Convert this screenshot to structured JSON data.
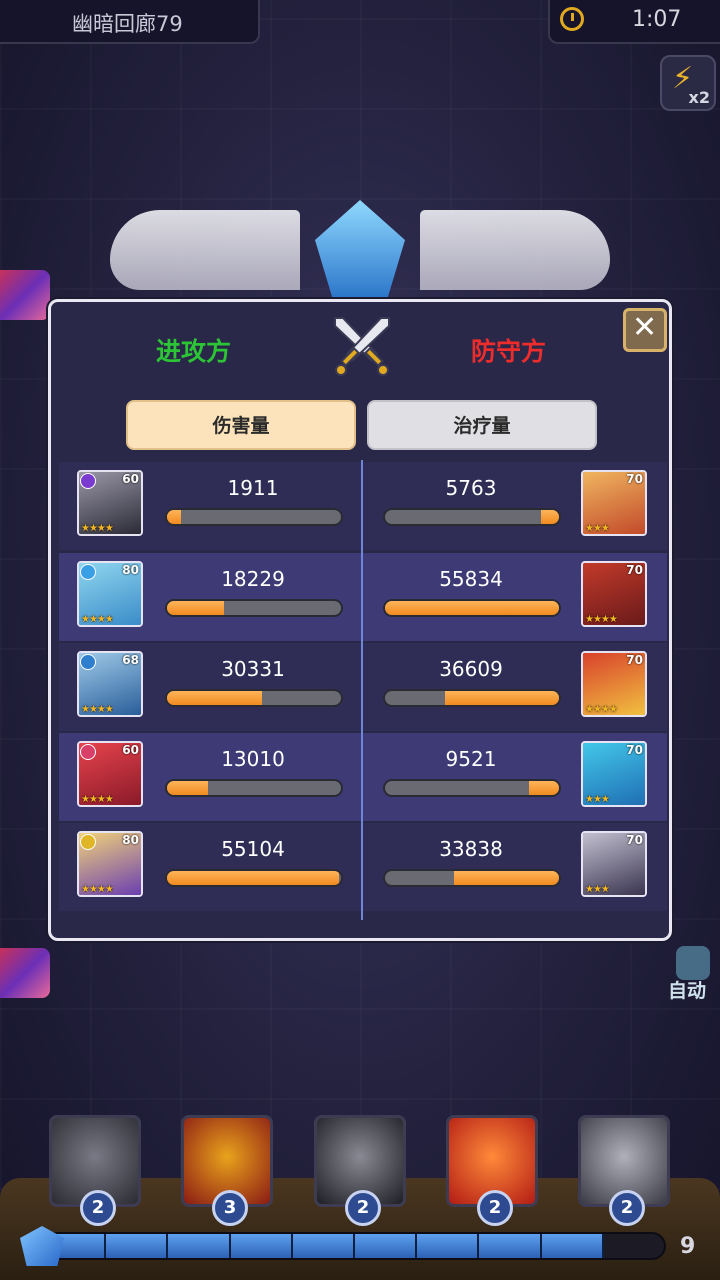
{
  "header": {
    "stage_name": "幽暗回廊79",
    "timer": "1:07",
    "speed_label": "x2",
    "auto_label": "自动"
  },
  "dialog": {
    "attacker_label": "进攻方",
    "defender_label": "防守方",
    "close_icon": "close-icon",
    "tabs": [
      {
        "label": "伤害量",
        "active": true
      },
      {
        "label": "治疗量",
        "active": false
      }
    ],
    "max_value": 55834,
    "rows": [
      {
        "left": {
          "value": "1911",
          "level": "60",
          "stars": "★★★★",
          "element_color": "#7b3bd0",
          "face": [
            "#9a98a8",
            "#2b2a36"
          ]
        },
        "right": {
          "value": "5763",
          "level": "70",
          "stars": "★★★",
          "face": [
            "#f0b560",
            "#c24a2a"
          ]
        }
      },
      {
        "left": {
          "value": "18229",
          "level": "80",
          "stars": "★★★★",
          "element_color": "#3aa0e6",
          "face": [
            "#8fd6ef",
            "#3b8cc9"
          ]
        },
        "right": {
          "value": "55834",
          "level": "70",
          "stars": "★★★★",
          "face": [
            "#c23a2a",
            "#6a1a1a"
          ]
        }
      },
      {
        "left": {
          "value": "30331",
          "level": "68",
          "stars": "★★★★",
          "element_color": "#2f7fcf",
          "face": [
            "#9ecae8",
            "#2a5e9a"
          ]
        },
        "right": {
          "value": "36609",
          "level": "70",
          "stars": "★★★★",
          "face": [
            "#d8422c",
            "#f1c040"
          ]
        }
      },
      {
        "left": {
          "value": "13010",
          "level": "60",
          "stars": "★★★★",
          "element_color": "#d8406a",
          "face": [
            "#e6434b",
            "#8a1a2a"
          ]
        },
        "right": {
          "value": "9521",
          "level": "70",
          "stars": "★★★",
          "face": [
            "#43c7ea",
            "#1f6fb3"
          ]
        }
      },
      {
        "left": {
          "value": "55104",
          "level": "80",
          "stars": "★★★★",
          "element_color": "#e0b526",
          "face": [
            "#f2d27a",
            "#6a3fb0"
          ]
        },
        "right": {
          "value": "33838",
          "level": "70",
          "stars": "★★★",
          "face": [
            "#c2c0d0",
            "#3a3450"
          ]
        }
      }
    ]
  },
  "skills": [
    {
      "name": "vortex",
      "cost": "2",
      "color": [
        "#7a7a86",
        "#2b2b33"
      ]
    },
    {
      "name": "fire-sigil",
      "cost": "3",
      "color": [
        "#e9a31c",
        "#8a1a14"
      ]
    },
    {
      "name": "dark-slash",
      "cost": "2",
      "color": [
        "#8a8a94",
        "#1e1e26"
      ]
    },
    {
      "name": "flame-strike",
      "cost": "2",
      "color": [
        "#ff8a3a",
        "#b21c14"
      ]
    },
    {
      "name": "spike-burst",
      "cost": "2",
      "color": [
        "#b0b0ba",
        "#3a3a44"
      ]
    }
  ],
  "energy": {
    "value": "9",
    "max": 10,
    "current": 9
  }
}
